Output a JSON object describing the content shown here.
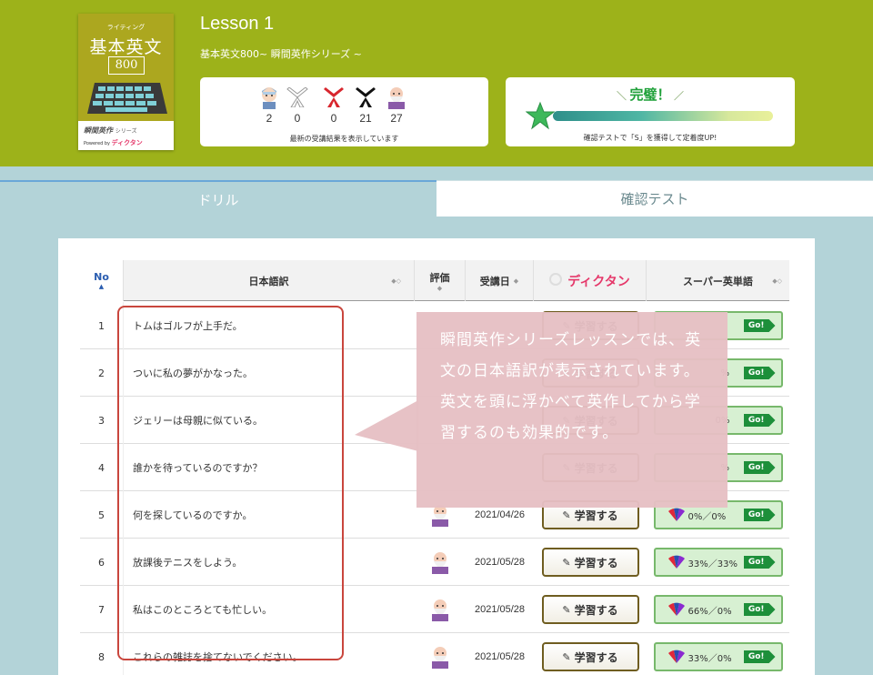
{
  "cover": {
    "small_text": "ライティング",
    "main_title": "基本英文",
    "number": "800",
    "series": "瞬間英作",
    "series_small": "シリーズ",
    "powered": "Powered by",
    "brand": "ディクタン"
  },
  "lesson": {
    "title": "Lesson 1",
    "subtitle": "基本英文800~ 瞬間英作シリーズ ~"
  },
  "stats": {
    "items": [
      {
        "icon": "student-face-icon",
        "value": "2"
      },
      {
        "icon": "white-belt-icon",
        "value": "0"
      },
      {
        "icon": "red-belt-icon",
        "value": "0"
      },
      {
        "icon": "black-belt-icon",
        "value": "21"
      },
      {
        "icon": "master-face-icon",
        "value": "27"
      }
    ],
    "caption": "最新の受講結果を表示しています"
  },
  "goal": {
    "title": "完璧！",
    "caption": "確認テストで「S」を獲得して定着度UP!",
    "colors": {
      "bar_start": "#2e8f8a",
      "bar_end": "#e9f09a",
      "star": "#3db85a"
    }
  },
  "tabs": {
    "drill": "ドリル",
    "test": "確認テスト"
  },
  "table": {
    "headers": {
      "no": "No",
      "jp": "日本語訳",
      "eval": "評価",
      "date": "受講日",
      "study_logo": "ディクタン",
      "super": "スーパー英単語"
    },
    "study_label": "学習する",
    "go_label": "Go!",
    "rows": [
      {
        "no": "1",
        "jp": "トムはゴルフが上手だ。",
        "date": "",
        "super": ""
      },
      {
        "no": "2",
        "jp": "ついに私の夢がかなった。",
        "date": "",
        "super": "%"
      },
      {
        "no": "3",
        "jp": "ジェリーは母親に似ている。",
        "date": "",
        "super": "0%"
      },
      {
        "no": "4",
        "jp": "誰かを待っているのですか？",
        "date": "",
        "super": "%"
      },
      {
        "no": "5",
        "jp": "何を探しているのですか。",
        "date": "2021/04/26",
        "super": "0%／0%"
      },
      {
        "no": "6",
        "jp": "放課後テニスをしよう。",
        "date": "2021/05/28",
        "super": "33%／33%"
      },
      {
        "no": "7",
        "jp": "私はこのところとても忙しい。",
        "date": "2021/05/28",
        "super": "66%／0%"
      },
      {
        "no": "8",
        "jp": "これらの雑誌を捨てないでください。",
        "date": "2021/05/28",
        "super": "33%／0%"
      }
    ]
  },
  "callout": {
    "text": "瞬間英作シリーズレッスンでは、英文の日本語訳が表示されています。英文を頭に浮かべて英作してから学習するのも効果的です。"
  },
  "colors": {
    "header_bg": "#9db21a",
    "page_bg": "#b3d3d8",
    "highlight": "#c9463d",
    "callout_bg": "#e6c0c4",
    "go_bg": "#1d8f3a"
  }
}
